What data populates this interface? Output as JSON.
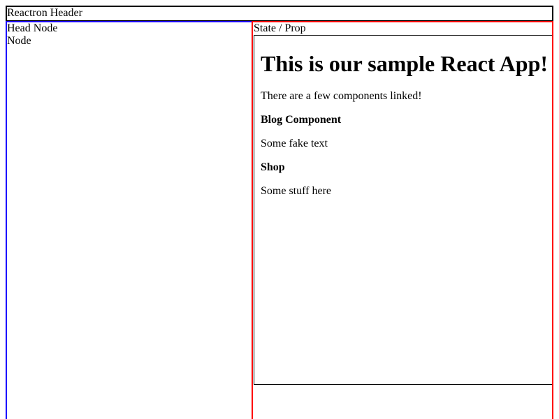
{
  "header": {
    "title": "Reactron Header"
  },
  "left_pane": {
    "tree": [
      "Head Node",
      "Node"
    ]
  },
  "right_pane": {
    "tab_label": "State / Prop",
    "app_preview": {
      "heading": "This is our sample React App!",
      "intro": "There are a few components linked!",
      "blog_title": "Blog Component",
      "blog_text": "Some fake text",
      "shop_title": "Shop",
      "shop_text": "Some stuff here"
    }
  },
  "colors": {
    "left_border": "#1a00ff",
    "right_border": "#ff0000",
    "header_border": "#000000"
  }
}
